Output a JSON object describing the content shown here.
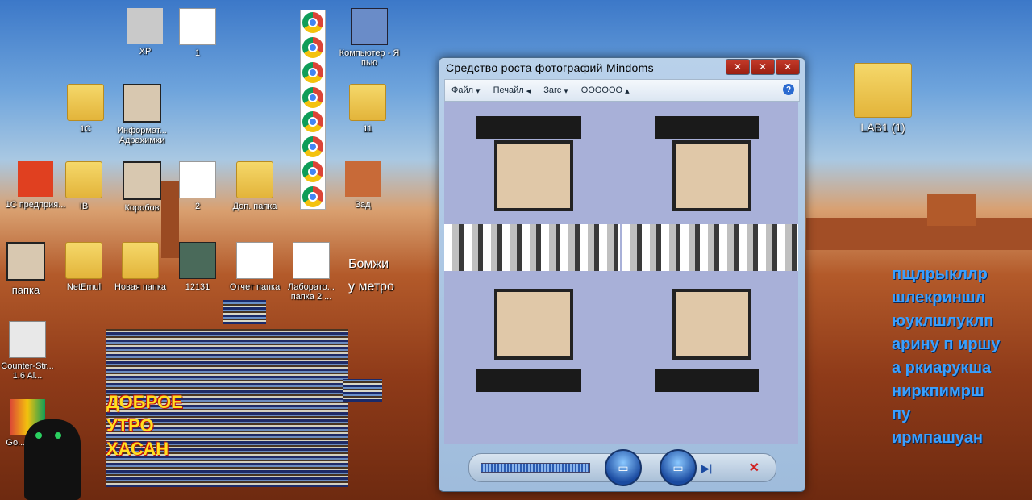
{
  "desktop": {
    "icons": [
      {
        "id": "xp",
        "label": "XP"
      },
      {
        "id": "one",
        "label": "1"
      },
      {
        "id": "computer",
        "label": "Компьютер - Я пью"
      },
      {
        "id": "1c",
        "label": "1С"
      },
      {
        "id": "informat",
        "label": "Информат... Адрахимхи"
      },
      {
        "id": "11",
        "label": "11"
      },
      {
        "id": "1c-pred",
        "label": "1С предприя..."
      },
      {
        "id": "ib",
        "label": "IB"
      },
      {
        "id": "korobov",
        "label": "Коробов"
      },
      {
        "id": "two",
        "label": "2"
      },
      {
        "id": "dop-papka",
        "label": "Доп. папка"
      },
      {
        "id": "zad",
        "label": "Зад"
      },
      {
        "id": "papka",
        "label": "папка"
      },
      {
        "id": "netemul",
        "label": "NetEmul"
      },
      {
        "id": "novaya-papka",
        "label": "Новая папка"
      },
      {
        "id": "12131",
        "label": "12131"
      },
      {
        "id": "otchet",
        "label": "Отчет папка"
      },
      {
        "id": "laborat",
        "label": "Лаборато... папка 2 ..."
      },
      {
        "id": "counter",
        "label": "Counter-Str... 1.6 Al..."
      },
      {
        "id": "google",
        "label": "Go... Chr..."
      },
      {
        "id": "lab1",
        "label": "LAB1 (1)"
      }
    ],
    "bomzh_text": "Бомжи у метро",
    "greeting_lines": [
      "ДОБРОЕ",
      "УТРО",
      "ХАСАН"
    ],
    "blue_lines": [
      "пщлрыкллр",
      "шлекриншл",
      "юуклшлуклп",
      "арину п иршу",
      "а ркиарукша",
      "ниркпимрш",
      "пу",
      "ирмпашуан"
    ]
  },
  "photo_viewer": {
    "title": "Средство   роста   фотографий Mindoms",
    "menu": {
      "file": "Файл",
      "print": "Печайл",
      "burn": "Загс",
      "open": "ОООООО"
    },
    "help": "?"
  }
}
